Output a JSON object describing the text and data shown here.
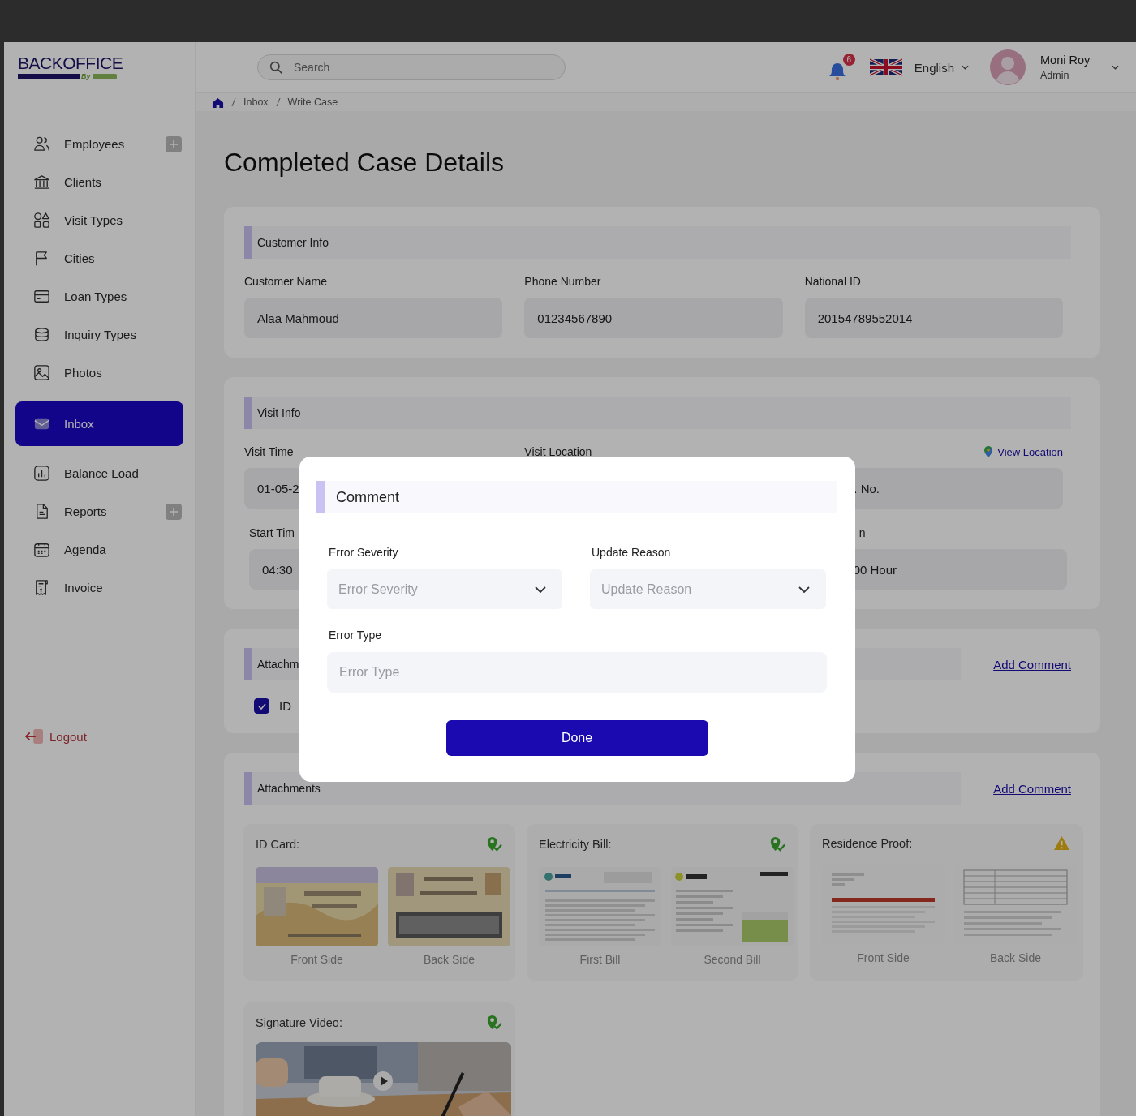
{
  "logo": {
    "text": "BACKOFFICE",
    "tagline": "By"
  },
  "header": {
    "search": {
      "placeholder": "Search"
    },
    "notifications": {
      "count": "6"
    },
    "language": "English",
    "user": {
      "name": "Moni Roy",
      "role": "Admin"
    }
  },
  "breadcrumb": [
    "Inbox",
    "Write Case"
  ],
  "sidebar": {
    "items": [
      {
        "label": "Employees",
        "selected": false,
        "has_add": true
      },
      {
        "label": "Clients",
        "selected": false,
        "has_add": false
      },
      {
        "label": "Visit Types",
        "selected": false,
        "has_add": false
      },
      {
        "label": "Cities",
        "selected": false,
        "has_add": false
      },
      {
        "label": "Loan Types",
        "selected": false,
        "has_add": false
      },
      {
        "label": "Inquiry Types",
        "selected": false,
        "has_add": false
      },
      {
        "label": "Photos",
        "selected": false,
        "has_add": false
      },
      {
        "label": "Inbox",
        "selected": true,
        "has_add": false
      },
      {
        "label": "Balance Load",
        "selected": false,
        "has_add": false
      },
      {
        "label": "Reports",
        "selected": false,
        "has_add": true
      },
      {
        "label": "Agenda",
        "selected": false,
        "has_add": false
      },
      {
        "label": "Invoice",
        "selected": false,
        "has_add": false
      }
    ],
    "logout": "Logout"
  },
  "page_title": "Completed Case Details",
  "customer_info": {
    "title": "Customer Info",
    "fields": [
      {
        "label": "Customer Name",
        "value": "Alaa Mahmoud"
      },
      {
        "label": "Phone Number",
        "value": "01234567890"
      },
      {
        "label": "National ID",
        "value": "20154789552014"
      }
    ]
  },
  "visit_info": {
    "title": "Visit Info",
    "link": "View Location",
    "visit_time": {
      "label": "Visit Time",
      "value": "01-05-2"
    },
    "visit_location": {
      "label": "Visit Location",
      "value": ". No."
    },
    "start_time": {
      "label": "Start Tim",
      "value": "04:30"
    },
    "column_3": {
      "label": "n",
      "value": "00 Hour"
    }
  },
  "attachments_check": {
    "title": "Attachm",
    "link": "Add Comment",
    "checkbox": {
      "label": "ID",
      "checked": true
    }
  },
  "attachments": {
    "title": "Attachments",
    "link": "Add Comment",
    "cards": [
      {
        "title": "ID Card:",
        "verified": true,
        "images": [
          {
            "caption": "Front Side",
            "kind": "id-front"
          },
          {
            "caption": "Back Side",
            "kind": "id-back"
          }
        ]
      },
      {
        "title": "Electricity Bill:",
        "verified": true,
        "images": [
          {
            "caption": "First Bill",
            "kind": "bill"
          },
          {
            "caption": "Second Bill",
            "kind": "bill-chart"
          }
        ]
      },
      {
        "title": "Residence Proof:",
        "verified": false,
        "images": [
          {
            "caption": "Front Side",
            "kind": "form"
          },
          {
            "caption": "Back Side",
            "kind": "table-form"
          }
        ]
      },
      {
        "title": "Signature Video:",
        "verified": true,
        "video": true
      }
    ]
  },
  "modal": {
    "title": "Comment",
    "selects": [
      {
        "label": "Error Severity",
        "placeholder": "Error Severity"
      },
      {
        "label": "Update Reason",
        "placeholder": "Update Reason"
      }
    ],
    "input": {
      "label": "Error Type",
      "placeholder": "Error Type"
    },
    "button": "Done"
  }
}
